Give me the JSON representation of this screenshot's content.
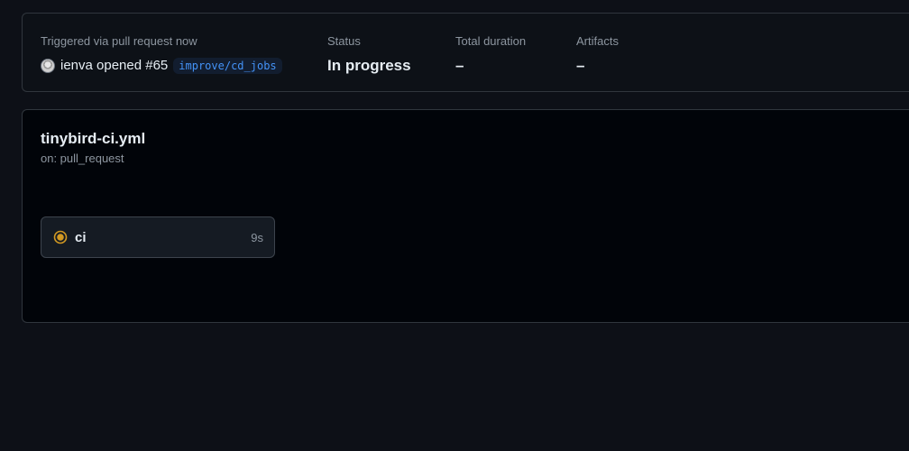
{
  "summary": {
    "trigger_label": "Triggered via pull request now",
    "trigger_user": "ienva",
    "trigger_action": "opened #65",
    "branch": "improve/cd_jobs",
    "status_label": "Status",
    "status_value": "In progress",
    "duration_label": "Total duration",
    "duration_value": "–",
    "artifacts_label": "Artifacts",
    "artifacts_value": "–"
  },
  "workflow": {
    "file": "tinybird-ci.yml",
    "event": "on: pull_request",
    "jobs": [
      {
        "name": "ci",
        "duration": "9s",
        "status_icon": "in-progress-icon",
        "status_color": "#d29922"
      }
    ]
  },
  "colors": {
    "page_bg": "#0d1017",
    "card_border": "#30363d",
    "branch_text": "#4493f8",
    "in_progress": "#d29922"
  }
}
